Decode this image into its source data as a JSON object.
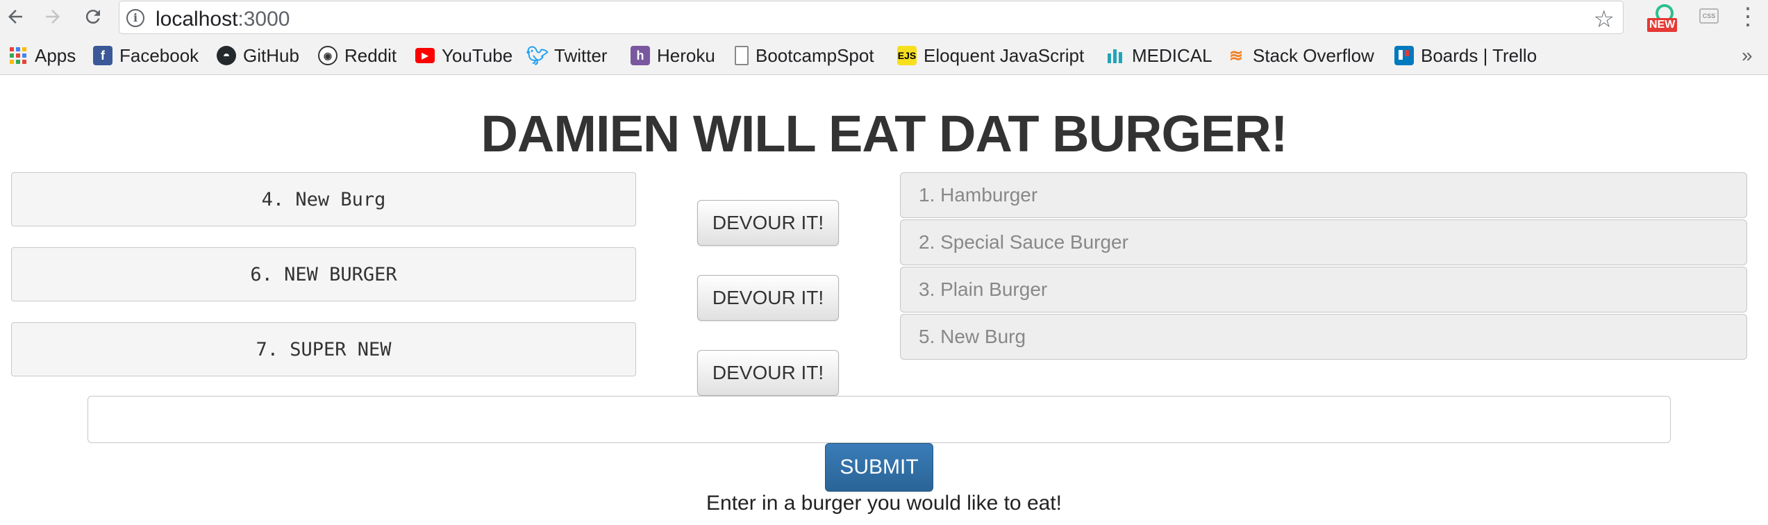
{
  "browser": {
    "url_host": "localhost",
    "url_port": ":3000",
    "extension_badge": "NEW",
    "extension_css": "CSS",
    "bookmarks": [
      {
        "label": "Apps",
        "icon": "apps-grid-icon"
      },
      {
        "label": "Facebook",
        "icon": "facebook-icon"
      },
      {
        "label": "GitHub",
        "icon": "github-icon"
      },
      {
        "label": "Reddit",
        "icon": "reddit-icon"
      },
      {
        "label": "YouTube",
        "icon": "youtube-icon"
      },
      {
        "label": "Twitter",
        "icon": "twitter-icon"
      },
      {
        "label": "Heroku",
        "icon": "heroku-icon"
      },
      {
        "label": "BootcampSpot",
        "icon": "page-icon"
      },
      {
        "label": "Eloquent JavaScript",
        "icon": "ejs-icon"
      },
      {
        "label": "MEDICAL",
        "icon": "medical-icon"
      },
      {
        "label": "Stack Overflow",
        "icon": "stackoverflow-icon"
      },
      {
        "label": "Boards | Trello",
        "icon": "trello-icon"
      }
    ],
    "more": "»"
  },
  "page": {
    "title": "DAMIEN WILL EAT DAT BURGER!",
    "uneaten": [
      "4. New Burg",
      "6. NEW BURGER",
      "7. SUPER NEW"
    ],
    "devour_label": "DEVOUR IT!",
    "eaten": [
      "1. Hamburger",
      "2. Special Sauce Burger",
      "3. Plain Burger",
      "5. New Burg"
    ],
    "input_value": "",
    "submit_label": "SUBMIT",
    "helper_text": "Enter in a burger you would like to eat!"
  },
  "colors": {
    "submit": "#2a6496",
    "eaten_text": "#888888"
  }
}
